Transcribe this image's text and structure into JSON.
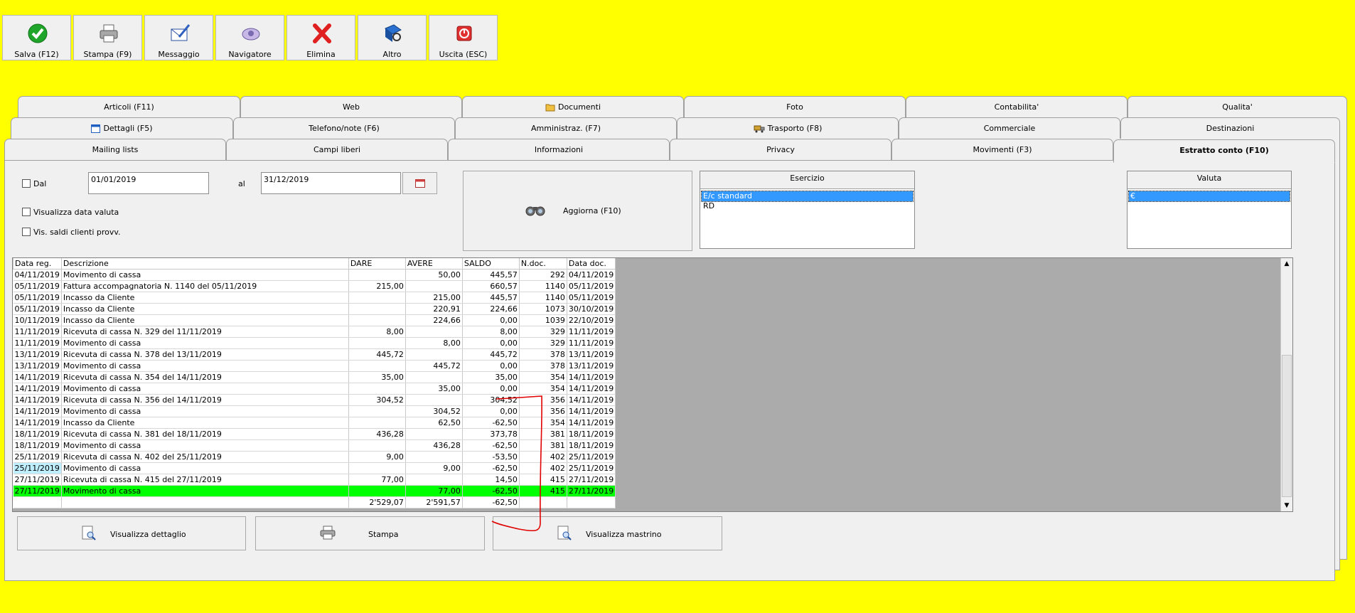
{
  "toolbar": [
    {
      "label": "Salva (F12)",
      "icon": "check-icon"
    },
    {
      "label": "Stampa (F9)",
      "icon": "printer-icon"
    },
    {
      "label": "Messaggio",
      "icon": "message-icon"
    },
    {
      "label": "Navigatore",
      "icon": "navigator-icon"
    },
    {
      "label": "Elimina",
      "icon": "delete-icon"
    },
    {
      "label": "Altro",
      "icon": "more-icon"
    },
    {
      "label": "Uscita (ESC)",
      "icon": "exit-icon"
    }
  ],
  "tabs": {
    "row1": [
      "Articoli (F11)",
      "Web",
      "Documenti",
      "Foto",
      "Contabilita'",
      "Qualita'"
    ],
    "row2": [
      "Dettagli (F5)",
      "Telefono/note (F6)",
      "Amministraz. (F7)",
      "Trasporto (F8)",
      "Commerciale",
      "Destinazioni"
    ],
    "row3": [
      "Mailing lists",
      "Campi liberi",
      "Informazioni",
      "Privacy",
      "Movimenti (F3)",
      "Estratto conto (F10)"
    ],
    "active": "Estratto conto (F10)"
  },
  "filters": {
    "dal_label": "Dal",
    "date_from": "01/01/2019",
    "al_label": "al",
    "date_to": "31/12/2019",
    "visualizza_data_valuta": "Visualizza data valuta",
    "vis_saldi": "Vis. saldi clienti provv.",
    "aggiorna": "Aggiorna (F10)"
  },
  "esercizio": {
    "header": "Esercizio",
    "options": [
      "E/c standard",
      "RD"
    ],
    "selected": "E/c standard"
  },
  "valuta": {
    "header": "Valuta",
    "options": [
      "€"
    ],
    "selected": "€"
  },
  "grid": {
    "columns": [
      "Data reg.",
      "Descrizione",
      "DARE",
      "AVERE",
      "SALDO",
      "N.doc.",
      "Data doc."
    ],
    "rows": [
      [
        "04/11/2019",
        "Movimento di cassa",
        "",
        "50,00",
        "445,57",
        "292",
        "04/11/2019"
      ],
      [
        "05/11/2019",
        "Fattura accompagnatoria N. 1140 del 05/11/2019",
        "215,00",
        "",
        "660,57",
        "1140",
        "05/11/2019"
      ],
      [
        "05/11/2019",
        "Incasso da Cliente",
        "",
        "215,00",
        "445,57",
        "1140",
        "05/11/2019"
      ],
      [
        "05/11/2019",
        "Incasso da Cliente",
        "",
        "220,91",
        "224,66",
        "1073",
        "30/10/2019"
      ],
      [
        "10/11/2019",
        "Incasso da Cliente",
        "",
        "224,66",
        "0,00",
        "1039",
        "22/10/2019"
      ],
      [
        "11/11/2019",
        "Ricevuta di cassa N. 329 del 11/11/2019",
        "8,00",
        "",
        "8,00",
        "329",
        "11/11/2019"
      ],
      [
        "11/11/2019",
        "Movimento di cassa",
        "",
        "8,00",
        "0,00",
        "329",
        "11/11/2019"
      ],
      [
        "13/11/2019",
        "Ricevuta di cassa N. 378 del 13/11/2019",
        "445,72",
        "",
        "445,72",
        "378",
        "13/11/2019"
      ],
      [
        "13/11/2019",
        "Movimento di cassa",
        "",
        "445,72",
        "0,00",
        "378",
        "13/11/2019"
      ],
      [
        "14/11/2019",
        "Ricevuta di cassa N. 354 del 14/11/2019",
        "35,00",
        "",
        "35,00",
        "354",
        "14/11/2019"
      ],
      [
        "14/11/2019",
        "Movimento di cassa",
        "",
        "35,00",
        "0,00",
        "354",
        "14/11/2019"
      ],
      [
        "14/11/2019",
        "Ricevuta di cassa N. 356 del 14/11/2019",
        "304,52",
        "",
        "304,52",
        "356",
        "14/11/2019"
      ],
      [
        "14/11/2019",
        "Movimento di cassa",
        "",
        "304,52",
        "0,00",
        "356",
        "14/11/2019"
      ],
      [
        "14/11/2019",
        "Incasso da Cliente",
        "",
        "62,50",
        "-62,50",
        "354",
        "14/11/2019"
      ],
      [
        "18/11/2019",
        "Ricevuta di cassa N. 381 del 18/11/2019",
        "436,28",
        "",
        "373,78",
        "381",
        "18/11/2019"
      ],
      [
        "18/11/2019",
        "Movimento di cassa",
        "",
        "436,28",
        "-62,50",
        "381",
        "18/11/2019"
      ],
      [
        "25/11/2019",
        "Ricevuta di cassa N. 402 del 25/11/2019",
        "9,00",
        "",
        "-53,50",
        "402",
        "25/11/2019"
      ],
      [
        "25/11/2019",
        "Movimento di cassa",
        "",
        "9,00",
        "-62,50",
        "402",
        "25/11/2019"
      ],
      [
        "27/11/2019",
        "Ricevuta di cassa N. 415 del 27/11/2019",
        "77,00",
        "",
        "14,50",
        "415",
        "27/11/2019"
      ],
      [
        "27/11/2019",
        "Movimento di cassa",
        "",
        "77,00",
        "-62,50",
        "415",
        "27/11/2019"
      ]
    ],
    "highlight_row_index": 19,
    "totals": [
      "",
      "",
      "2'529,07",
      "2'591,57",
      "-62,50",
      "",
      ""
    ]
  },
  "bottom_buttons": [
    "Visualizza dettaglio",
    "Stampa",
    "Visualizza mastrino"
  ],
  "colors": {
    "background": "#ffff00",
    "highlight": "#00ff00",
    "selection": "#3399ff",
    "annotation": "#e00000"
  }
}
